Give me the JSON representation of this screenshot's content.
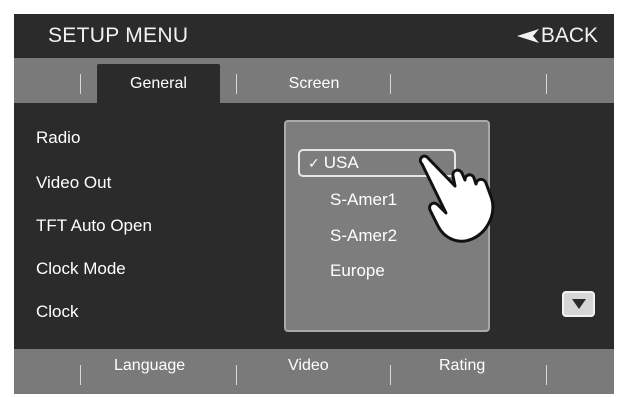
{
  "header": {
    "title": "SETUP MENU",
    "back_label": "BACK"
  },
  "tabs_top": [
    "General",
    "Screen"
  ],
  "active_tab": "General",
  "menu": {
    "items": [
      "Radio",
      "Video Out",
      "TFT Auto Open",
      "Clock Mode",
      "Clock"
    ]
  },
  "dropdown": {
    "selected": "USA",
    "options": [
      "USA",
      "S-Amer1",
      "S-Amer2",
      "Europe"
    ]
  },
  "tabs_bottom": [
    "Language",
    "Video",
    "Rating"
  ],
  "icons": {
    "back": "back-arrow-icon",
    "check": "check-icon",
    "scroll_down": "triangle-down-icon",
    "pointer": "pointing-hand-icon"
  },
  "colors": {
    "bg_dark": "#2b2b2b",
    "bar_gray": "#7a7a7a",
    "dropdown_bg": "#7d7d7d",
    "text": "#ffffff"
  }
}
